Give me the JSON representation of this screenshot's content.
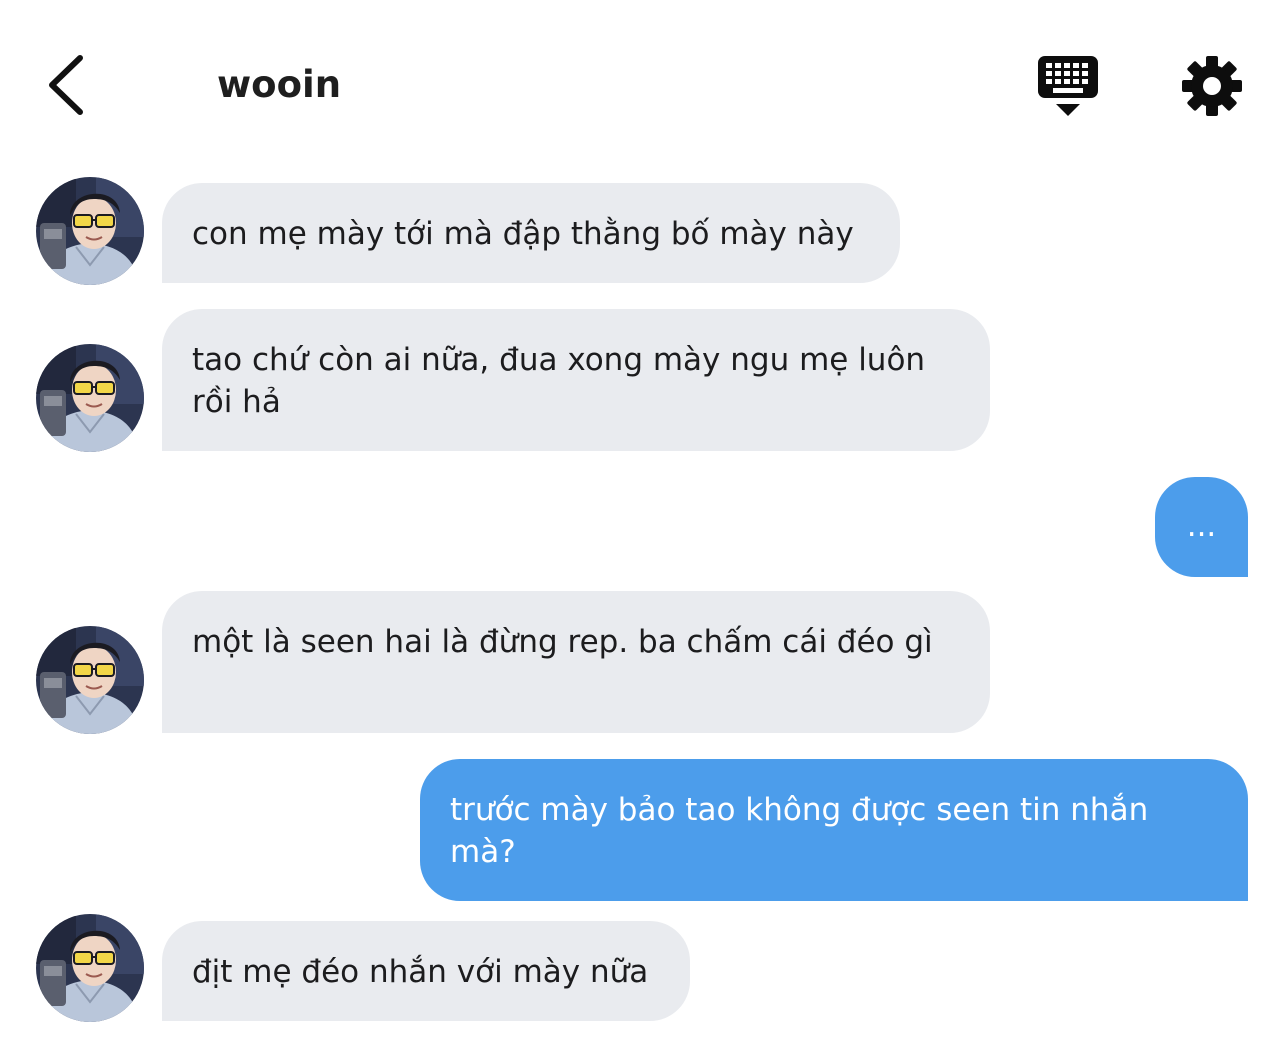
{
  "header": {
    "title": "wooin",
    "back_icon": "chevron-left-icon",
    "keyboard_icon": "keyboard-icon",
    "settings_icon": "gear-icon"
  },
  "colors": {
    "incoming_bubble": "#e9ebef",
    "outgoing_bubble": "#4c9deb",
    "text_dark": "#1c1c1e"
  },
  "messages": [
    {
      "from": "wooin",
      "text": "con mẹ mày tới mà đập thằng bố mày này"
    },
    {
      "from": "wooin",
      "text": "tao chứ còn ai nữa, đua xong mày ngu mẹ luôn rồi hả"
    },
    {
      "from": "me",
      "text": "..."
    },
    {
      "from": "wooin",
      "text": "một là seen hai là đừng rep. ba chấm cái đéo gì"
    },
    {
      "from": "me",
      "text": "trước mày bảo tao không được seen tin nhắn mà?"
    },
    {
      "from": "wooin",
      "text": "địt mẹ đéo nhắn với mày nữa"
    }
  ]
}
